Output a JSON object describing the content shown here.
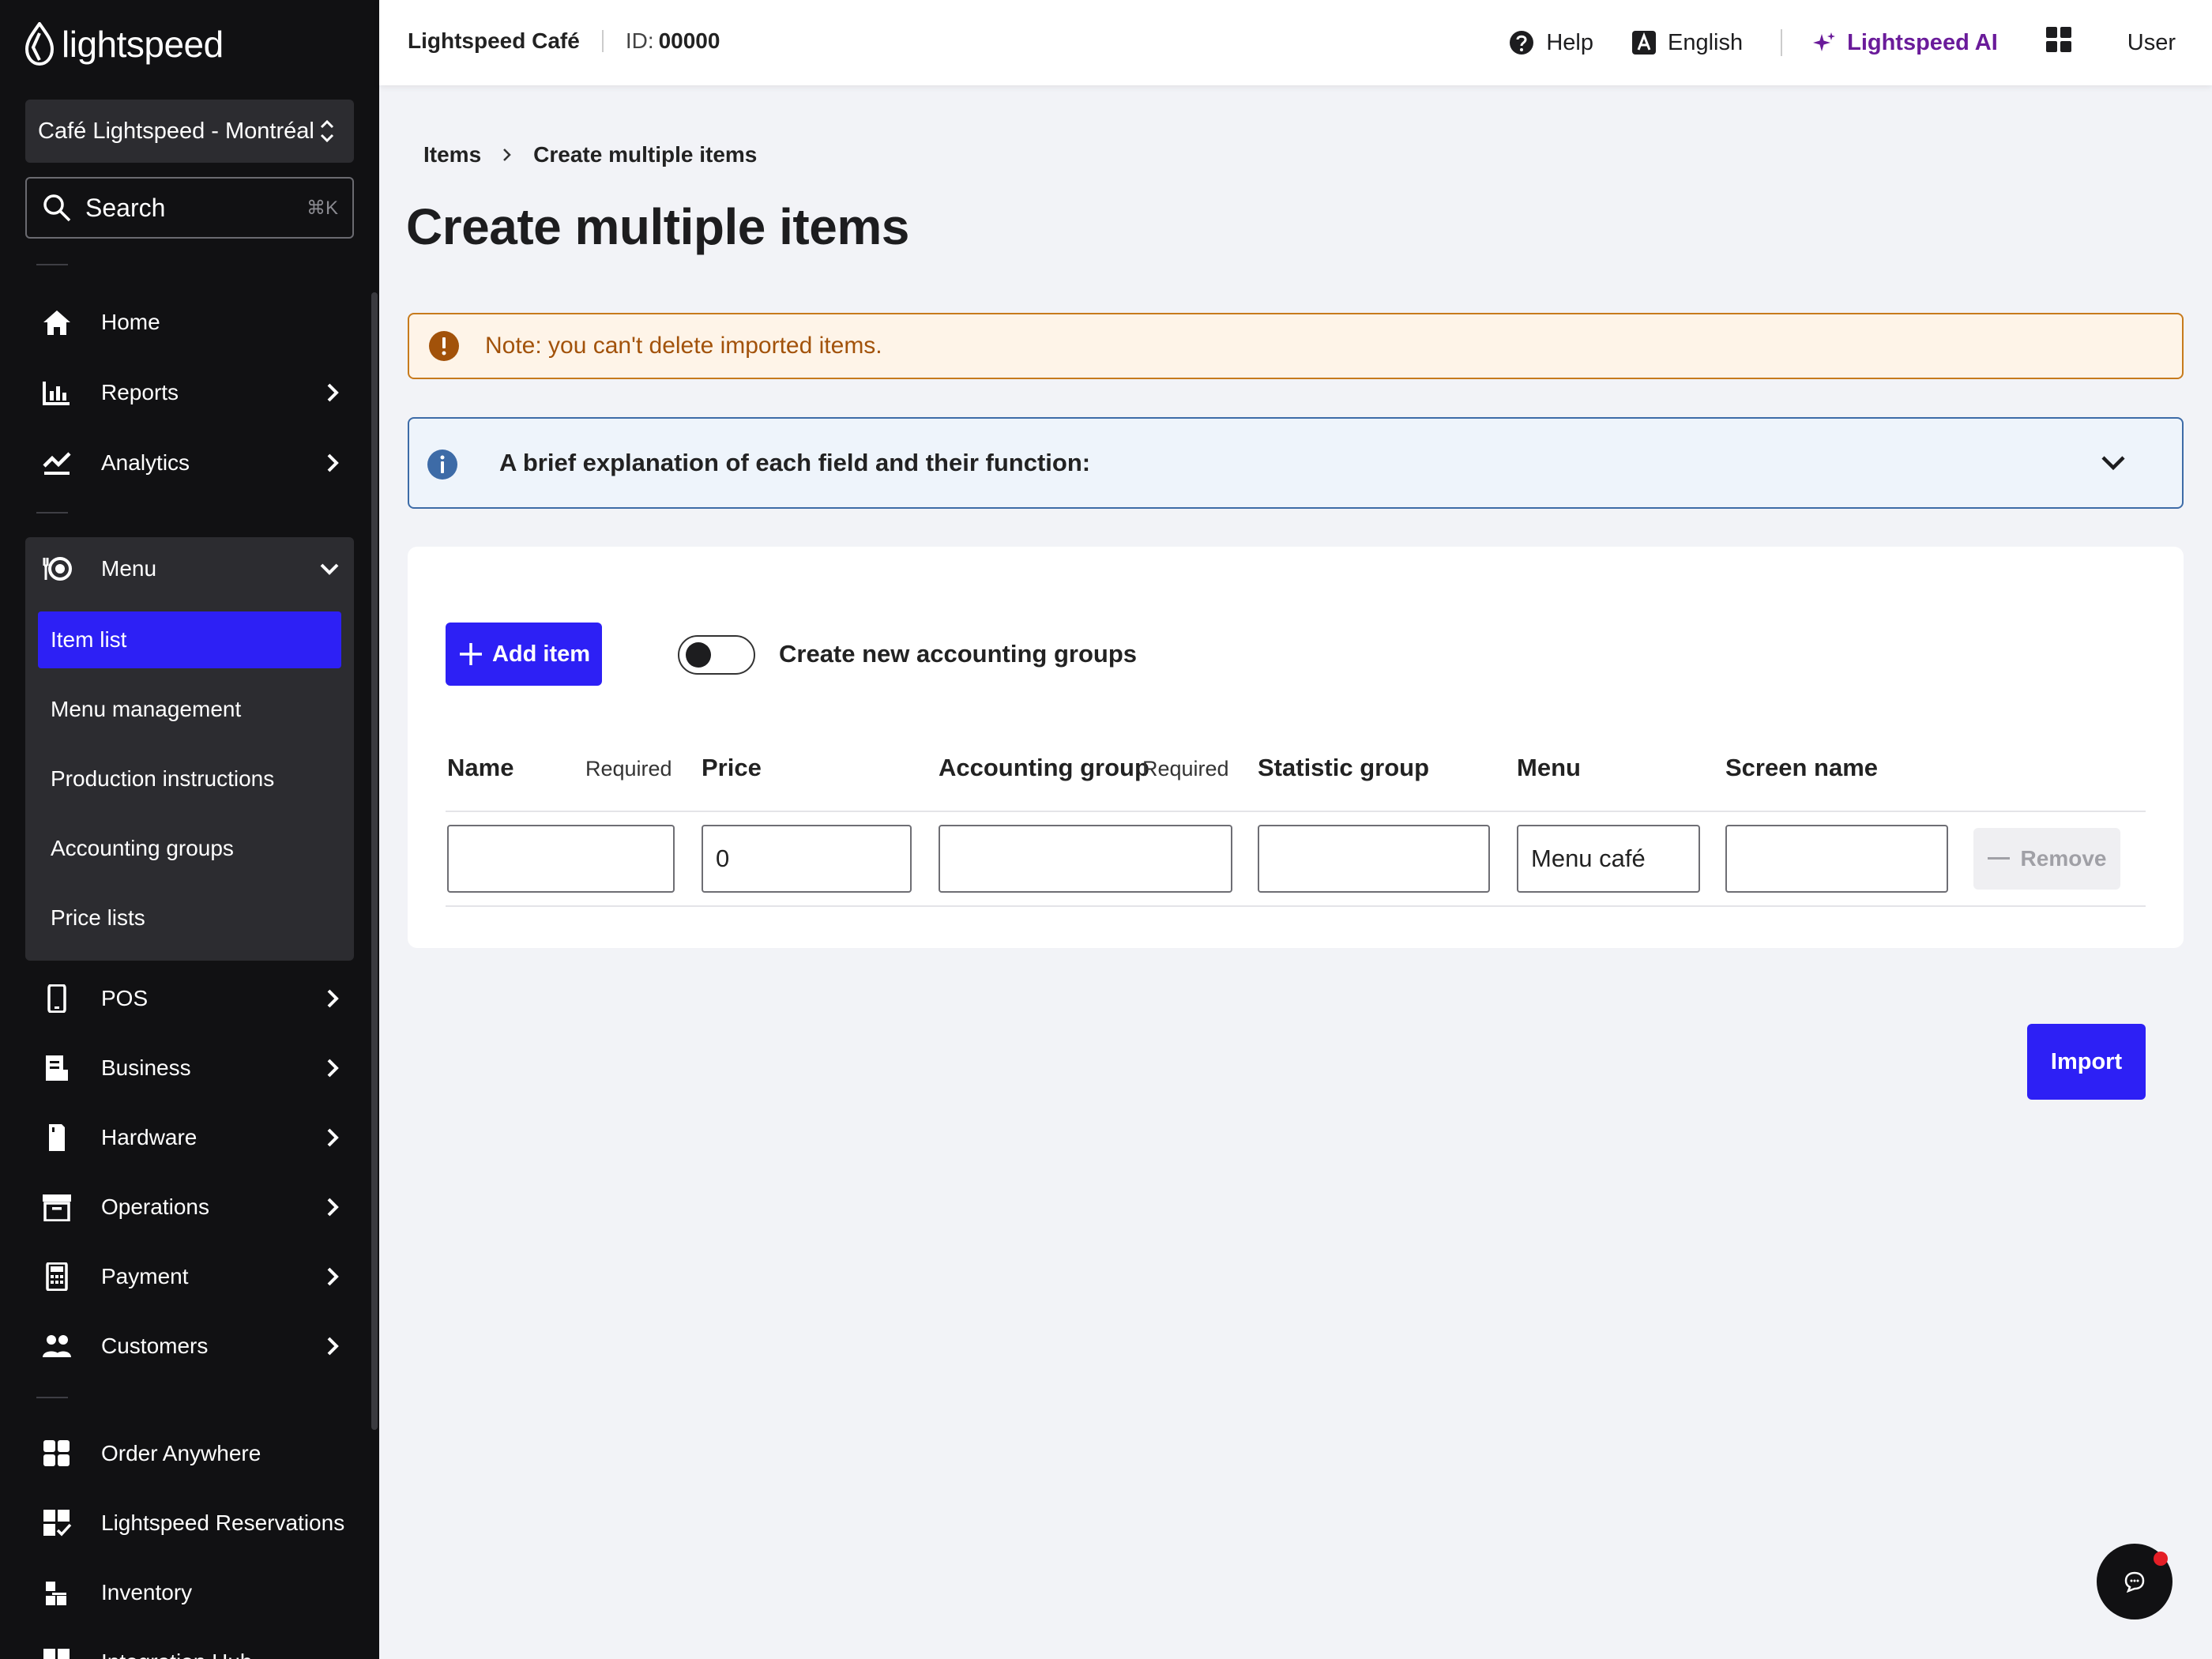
{
  "sidebar": {
    "logo_text": "lightspeed",
    "location": "Café Lightspeed - Montréal",
    "search": {
      "label": "Search",
      "shortcut": "⌘K"
    },
    "items": [
      {
        "label": "Home",
        "icon": "home-icon"
      },
      {
        "label": "Reports",
        "icon": "reports-icon"
      },
      {
        "label": "Analytics",
        "icon": "analytics-icon"
      },
      {
        "label": "Menu",
        "icon": "menu-icon"
      },
      {
        "label": "POS",
        "icon": "pos-icon"
      },
      {
        "label": "Business",
        "icon": "business-icon"
      },
      {
        "label": "Hardware",
        "icon": "hardware-icon"
      },
      {
        "label": "Operations",
        "icon": "operations-icon"
      },
      {
        "label": "Payment",
        "icon": "payment-icon"
      },
      {
        "label": "Customers",
        "icon": "customers-icon"
      },
      {
        "label": "Order Anywhere",
        "icon": "order-anywhere-icon"
      },
      {
        "label": "Lightspeed Reservations",
        "icon": "reservations-icon"
      },
      {
        "label": "Inventory",
        "icon": "inventory-icon"
      },
      {
        "label": "Integration Hub",
        "icon": "integration-hub-icon"
      }
    ],
    "menu_sub": [
      "Item list",
      "Menu management",
      "Production instructions",
      "Accounting groups",
      "Price lists"
    ]
  },
  "topbar": {
    "venue": "Lightspeed Café",
    "id_label": "ID:",
    "id_value": "00000",
    "help": "Help",
    "language": "English",
    "ai": "Lightspeed AI",
    "user": "User"
  },
  "breadcrumb": {
    "parent": "Items",
    "current": "Create multiple items"
  },
  "page_title": "Create multiple items",
  "note": "Note: you can't delete imported items.",
  "info": "A brief explanation of each field and their function:",
  "form": {
    "add_item": "Add item",
    "toggle_label": "Create new accounting groups",
    "columns": {
      "name": "Name",
      "name_req": "Required",
      "price": "Price",
      "accounting": "Accounting group",
      "accounting_req": "Required",
      "statistic": "Statistic group",
      "menu": "Menu",
      "screen": "Screen name"
    },
    "row": {
      "name": "",
      "price": "0",
      "accounting": "",
      "statistic": "",
      "menu": "Menu café",
      "screen": ""
    },
    "remove": "Remove"
  },
  "import": "Import",
  "colors": {
    "primary": "#2d20f5",
    "sidebar": "#111113",
    "warning": "#c77a1c",
    "info": "#3d6ba7",
    "ai": "#6a1b9a"
  }
}
